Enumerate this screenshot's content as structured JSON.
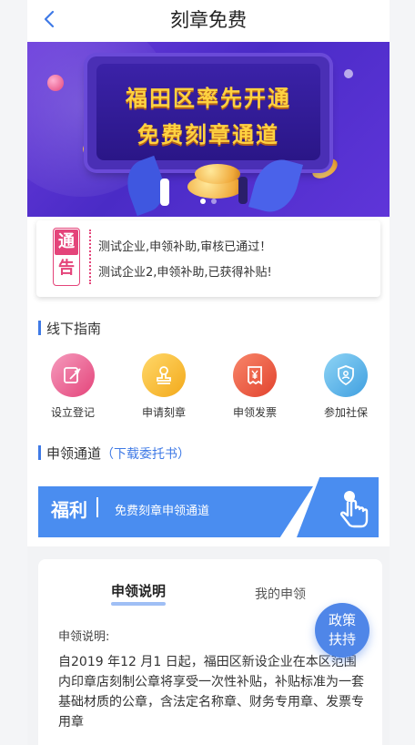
{
  "header": {
    "title": "刻章免费"
  },
  "banner": {
    "line1": "福田区率先开通",
    "line2": "免费刻章通道",
    "colors": {
      "bg": "#5a34d6",
      "text": "#ffd240"
    }
  },
  "notice": {
    "badge_top": "通",
    "badge_bottom": "告",
    "items": [
      "测试企业,申领补助,审核已通过！",
      "测试企业2,申领补助,已获得补贴!"
    ]
  },
  "offline_guide": {
    "title": "线下指南",
    "items": [
      {
        "label": "设立登记",
        "icon": "feather-certificate-icon",
        "color": "#ec6a99"
      },
      {
        "label": "申请刻章",
        "icon": "stamp-icon",
        "color": "#f6b624"
      },
      {
        "label": "申领发票",
        "icon": "yuan-receipt-icon",
        "color": "#eb5a43"
      },
      {
        "label": "参加社保",
        "icon": "shield-icon",
        "color": "#5eb6ea"
      }
    ]
  },
  "apply_channel": {
    "title": "申领通道",
    "link": "（下载委托书）"
  },
  "welfare": {
    "title": "福利",
    "text": "免费刻章申领通道",
    "icon": "tap-hand-icon",
    "color": "#4a8df0"
  },
  "card": {
    "tabs": [
      "申领说明",
      "我的申领"
    ],
    "label": "申领说明:",
    "paragraph": "自2019 年12 月1 日起，福田区新设企业在本区范围内印章店刻制公章将享受一次性补贴，补贴标准为一套基础材质的公章，含法定名称章、财务专用章、发票专用章"
  },
  "float_button": {
    "line1": "政策",
    "line2": "扶持"
  }
}
